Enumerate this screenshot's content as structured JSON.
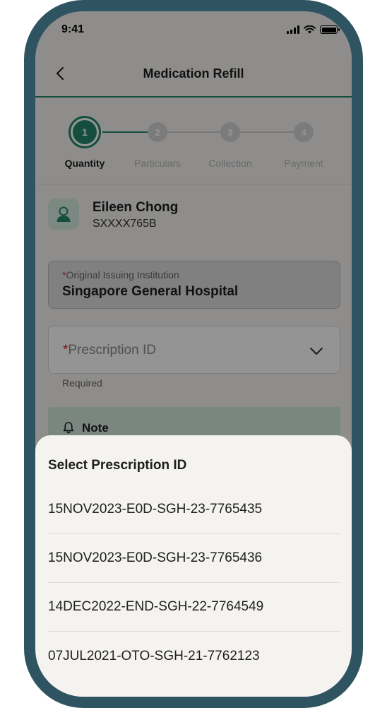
{
  "status_bar": {
    "time": "9:41"
  },
  "header": {
    "title": "Medication Refill"
  },
  "stepper": {
    "steps": [
      {
        "number": "1",
        "label": "Quantity",
        "active": true
      },
      {
        "number": "2",
        "label": "Particulars",
        "active": false
      },
      {
        "number": "3",
        "label": "Collection",
        "active": false
      },
      {
        "number": "4",
        "label": "Payment",
        "active": false
      }
    ]
  },
  "profile": {
    "name": "Eileen Chong",
    "id": "SXXXX765B"
  },
  "institution_field": {
    "required_mark": "*",
    "label": "Original Issuing Institution",
    "value": "Singapore General Hospital"
  },
  "prescription_field": {
    "required_mark": "*",
    "placeholder": "Prescription ID",
    "helper": "Required"
  },
  "note": {
    "title": "Note"
  },
  "sheet": {
    "title": "Select Prescription ID",
    "options": [
      "15NOV2023-E0D-SGH-23-7765435",
      "15NOV2023-E0D-SGH-23-7765436",
      "14DEC2022-END-SGH-22-7764549",
      "07JUL2021-OTO-SGH-21-7762123"
    ]
  },
  "colors": {
    "frame": "#2f5461",
    "accent": "#23886a",
    "required": "#d32f2f",
    "note_bg": "#d3e7dc"
  }
}
